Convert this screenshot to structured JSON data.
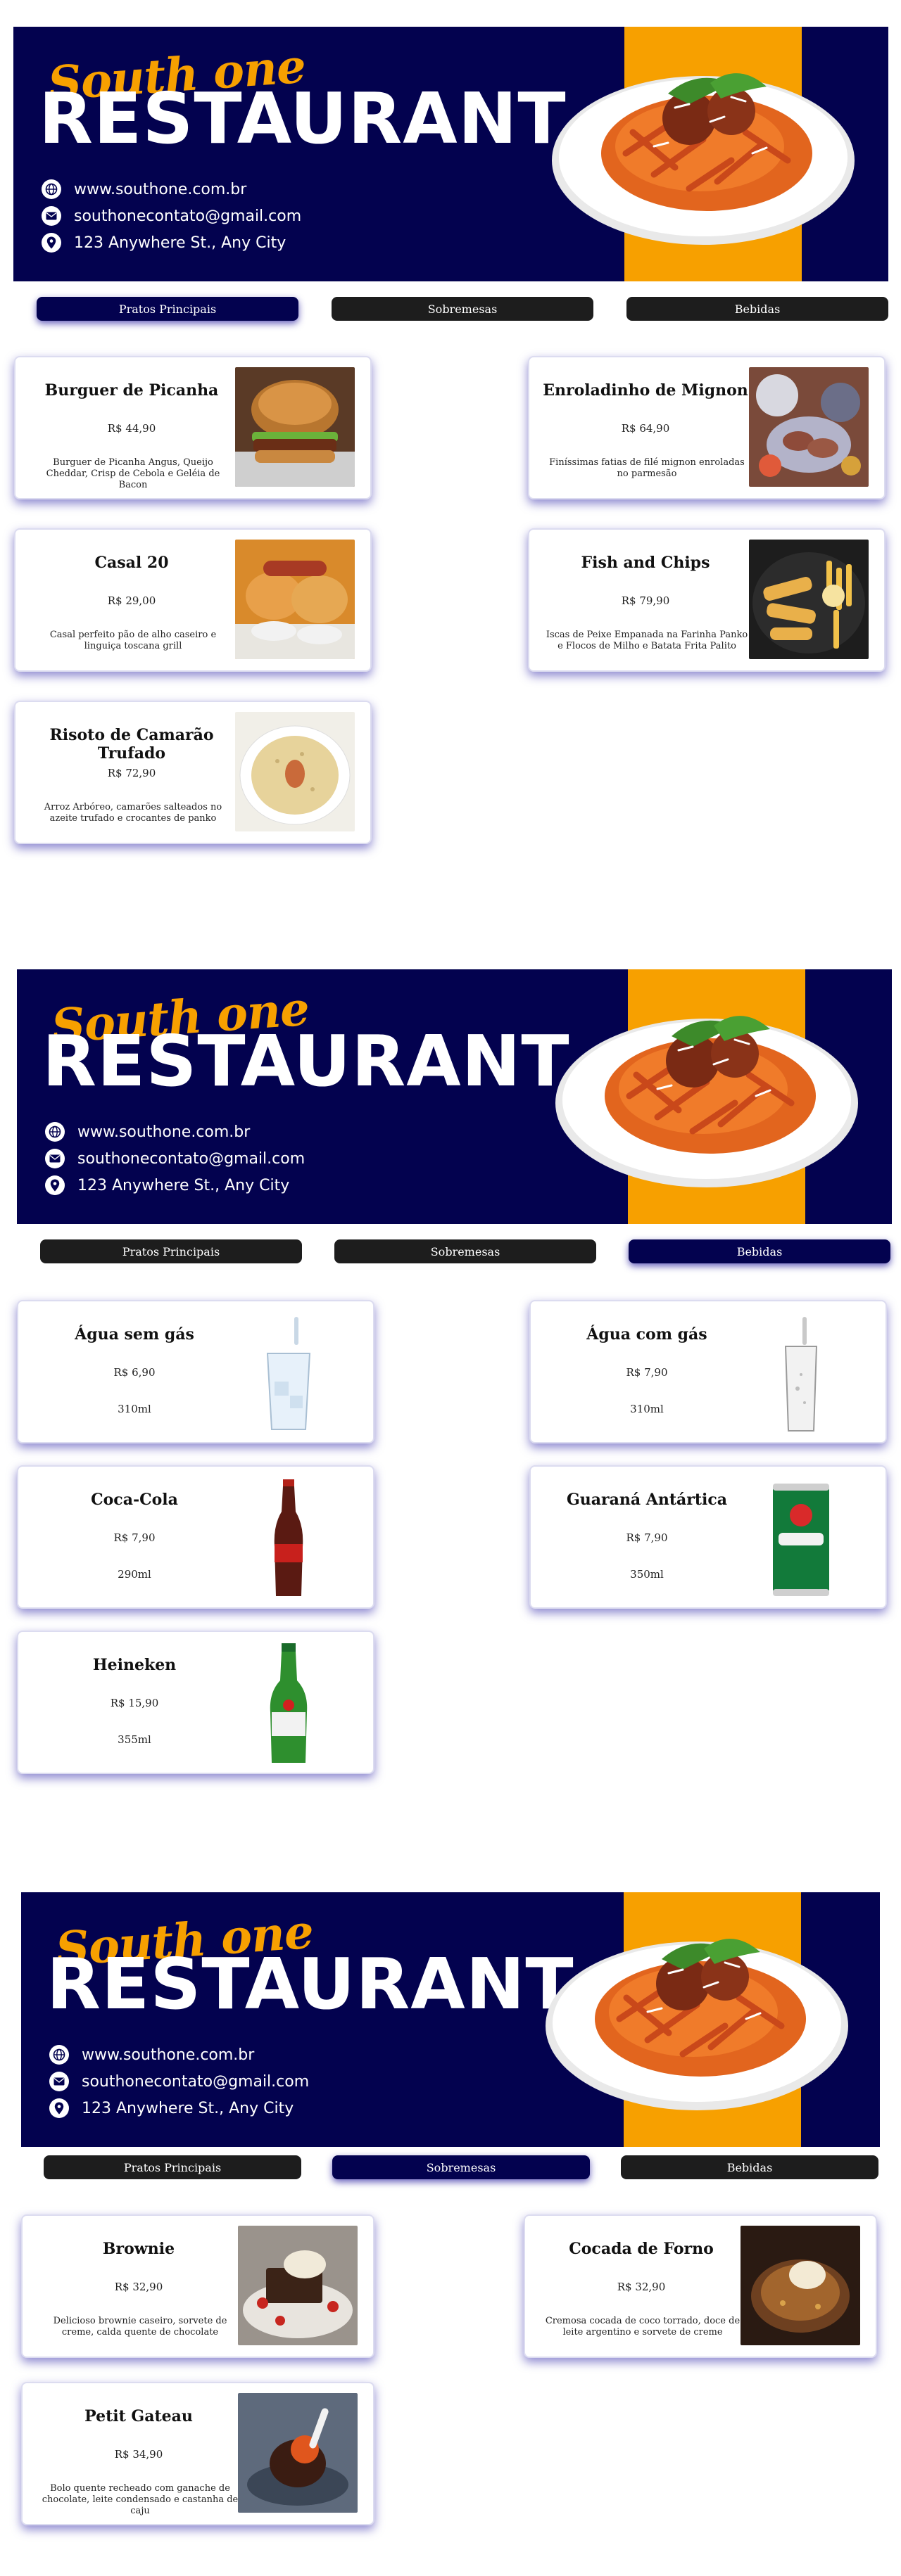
{
  "restaurant": {
    "brand_script": "South one",
    "brand_main": "RESTAURANT",
    "website": "www.southone.com.br",
    "email": "southonecontato@gmail.com",
    "address": "123 Anywhere St., Any City"
  },
  "tabs": [
    {
      "label": "Pratos Principais"
    },
    {
      "label": "Sobremesas"
    },
    {
      "label": "Bebidas"
    }
  ],
  "colors": {
    "navy": "#03024f",
    "orange": "#f7a000",
    "tab_dark": "#1d1d1d"
  },
  "pages": [
    {
      "active_tab": "Pratos Principais",
      "items": [
        {
          "name": "Burguer de Picanha",
          "price": "R$ 44,90",
          "desc": "Burguer de Picanha Angus, Queijo Cheddar, Crisp de Cebola e Geléia de Bacon",
          "image": "burger-photo"
        },
        {
          "name": "Enroladinho de Mignon",
          "price": "R$ 64,90",
          "desc": "Finíssimas fatias de filé mignon enroladas no parmesão",
          "image": "mignon-rolls-photo"
        },
        {
          "name": "Casal 20",
          "price": "R$ 29,00",
          "desc": "Casal perfeito pão de alho caseiro e linguiça toscana grill",
          "image": "garlic-bread-sausage-photo"
        },
        {
          "name": "Fish and Chips",
          "price": "R$ 79,90",
          "desc": "Iscas de Peixe Empanada na Farinha Panko e Flocos de Milho e Batata Frita Palito",
          "image": "fish-and-chips-photo"
        },
        {
          "name": "Risoto de Camarão Trufado",
          "price": "R$ 72,90",
          "desc": "Arroz Arbóreo, camarões salteados no azeite trufado e crocantes de panko",
          "image": "shrimp-risotto-photo"
        }
      ]
    },
    {
      "active_tab": "Bebidas",
      "items": [
        {
          "name": "Água sem gás",
          "price": "R$ 6,90",
          "volume": "310ml",
          "image": "water-glass-icon"
        },
        {
          "name": "Água com gás",
          "price": "R$ 7,90",
          "volume": "310ml",
          "image": "sparkling-water-glass-icon"
        },
        {
          "name": "Coca-Cola",
          "price": "R$ 7,90",
          "volume": "290ml",
          "image": "coca-cola-bottle-icon"
        },
        {
          "name": "Guaraná Antártica",
          "price": "R$ 7,90",
          "volume": "350ml",
          "image": "guarana-can-icon"
        },
        {
          "name": "Heineken",
          "price": "R$ 15,90",
          "volume": "355ml",
          "image": "heineken-bottle-icon"
        }
      ]
    },
    {
      "active_tab": "Sobremesas",
      "items": [
        {
          "name": "Brownie",
          "price": "R$ 32,90",
          "desc": "Delicioso brownie caseiro, sorvete de creme, calda quente de chocolate",
          "image": "brownie-photo"
        },
        {
          "name": "Cocada de Forno",
          "price": "R$ 32,90",
          "desc": "Cremosa cocada de coco torrado, doce de leite argentino e sorvete de creme",
          "image": "cocada-photo"
        },
        {
          "name": "Petit Gateau",
          "price": "R$ 34,90",
          "desc": "Bolo quente recheado com ganache de chocolate, leite condensado e castanha de caju",
          "image": "petit-gateau-photo"
        }
      ]
    }
  ]
}
